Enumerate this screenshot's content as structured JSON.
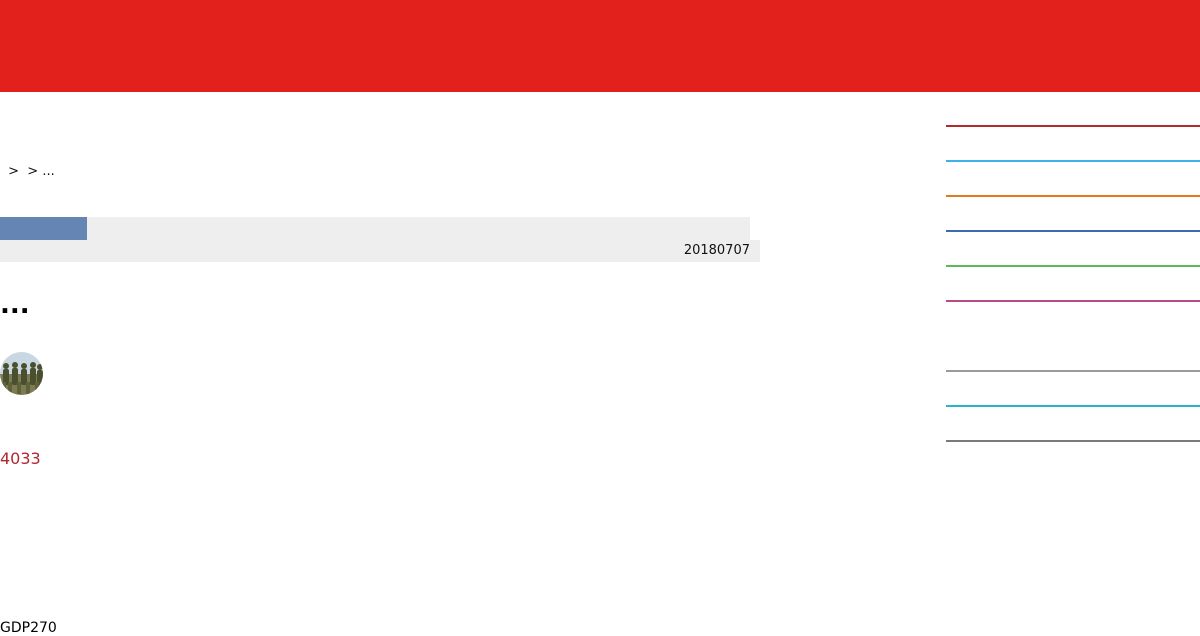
{
  "header": {
    "background_color": "#e3211c"
  },
  "breadcrumb": {
    "text": " >  > ..."
  },
  "progress": {
    "fraction": 0.116,
    "fill_color": "#6586b5",
    "track_color": "#eeeeee"
  },
  "article": {
    "date": "20180707",
    "title": "...",
    "count": "4033",
    "count_color": "#b0272f",
    "bottom_text": "GDP270"
  },
  "avatar": {
    "icon": "soldiers-photo-icon"
  },
  "sidebar": {
    "rule_colors": [
      "#b22a2a",
      "#3fb2e5",
      "#e07a20",
      "#3d6bb3",
      "#5cb85c",
      "#b84a8c",
      "#9a9a9a",
      "#2bb3c8",
      "#7a7a7a"
    ]
  }
}
